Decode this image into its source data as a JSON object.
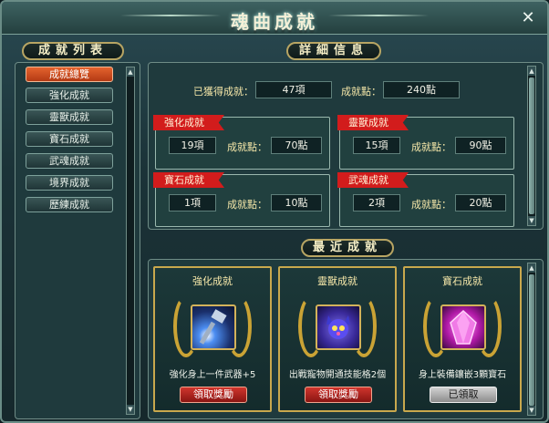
{
  "window": {
    "title": "魂曲成就",
    "close_symbol": "✕"
  },
  "sidebar": {
    "header": "成就列表",
    "items": [
      {
        "label": "成就總覽",
        "active": true
      },
      {
        "label": "強化成就",
        "active": false
      },
      {
        "label": "靈獸成就",
        "active": false
      },
      {
        "label": "寶石成就",
        "active": false
      },
      {
        "label": "武魂成就",
        "active": false
      },
      {
        "label": "境界成就",
        "active": false
      },
      {
        "label": "歷練成就",
        "active": false
      }
    ]
  },
  "details": {
    "header": "詳細信息",
    "obtained_label": "已獲得成就：",
    "obtained_value": "47項",
    "points_label": "成就點：",
    "points_value": "240點",
    "categories": [
      {
        "name": "強化成就",
        "count": "19項",
        "points_label": "成就點：",
        "points": "70點"
      },
      {
        "name": "靈獸成就",
        "count": "15項",
        "points_label": "成就點：",
        "points": "90點"
      },
      {
        "name": "寶石成就",
        "count": "1項",
        "points_label": "成就點：",
        "points": "10點"
      },
      {
        "name": "武魂成就",
        "count": "2項",
        "points_label": "成就點：",
        "points": "20點"
      }
    ]
  },
  "recent": {
    "header": "最近成就",
    "cards": [
      {
        "title": "強化成就",
        "icon": "hammer-icon",
        "desc": "強化身上一件武器+5",
        "button": "領取獎勵",
        "claimed": false
      },
      {
        "title": "靈獸成就",
        "icon": "spirit-beast-icon",
        "desc": "出戰寵物開通技能格2個",
        "button": "領取獎勵",
        "claimed": false
      },
      {
        "title": "寶石成就",
        "icon": "gem-icon",
        "desc": "身上裝備鑲嵌3顆寶石",
        "button": "已領取",
        "claimed": true
      }
    ]
  },
  "colors": {
    "accent_red": "#d21c1c",
    "active_orange": "#e4632e",
    "gold": "#c9a84d"
  }
}
